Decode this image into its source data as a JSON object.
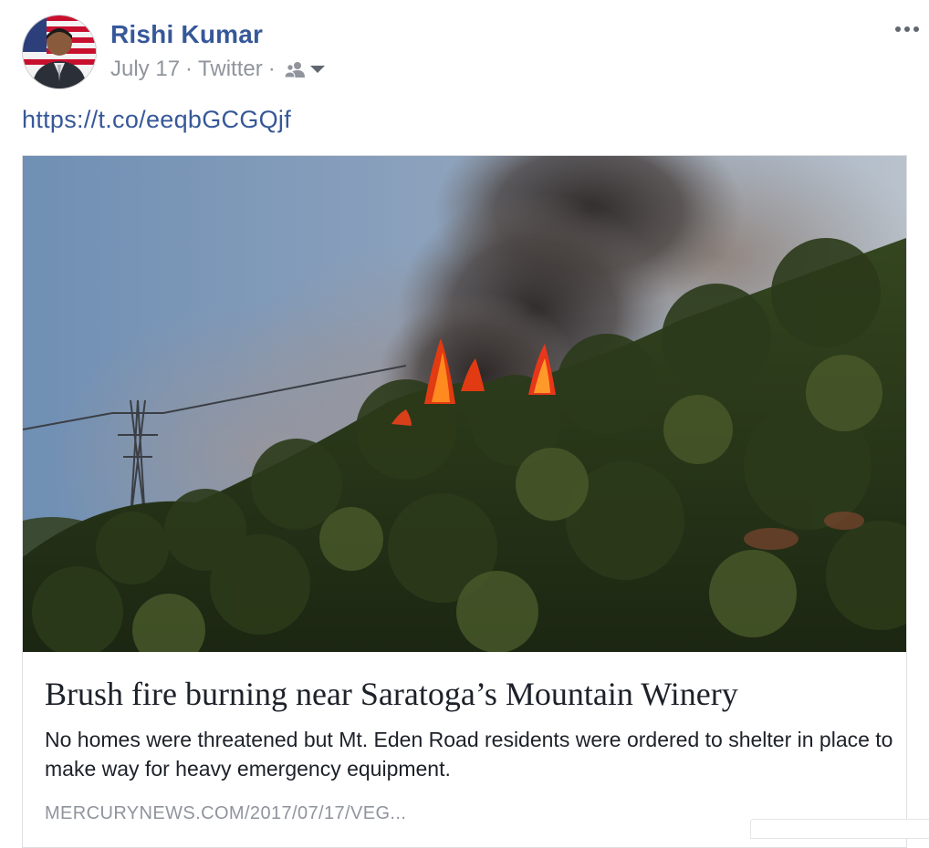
{
  "post": {
    "author_name": "Rishi Kumar",
    "date": "July 17",
    "separator": "·",
    "source": "Twitter",
    "audience_icon": "friends-icon",
    "audience_dropdown_icon": "caret-down-icon",
    "more_icon": "more-horizontal-icon",
    "link_text": "https://t.co/eeqbGCGQjf"
  },
  "link_card": {
    "image_description_icon": "wildfire-photo",
    "title": "Brush fire burning near Saratoga’s Mountain Winery",
    "description": "No homes were threatened but Mt. Eden Road residents were ordered to shelter in place to make way for heavy emergency equipment.",
    "domain": "MERCURYNEWS.COM/2017/07/17/VEG..."
  },
  "colors": {
    "link": "#365899",
    "meta": "#90949c",
    "text": "#1d2129",
    "border": "#dddfe2"
  }
}
